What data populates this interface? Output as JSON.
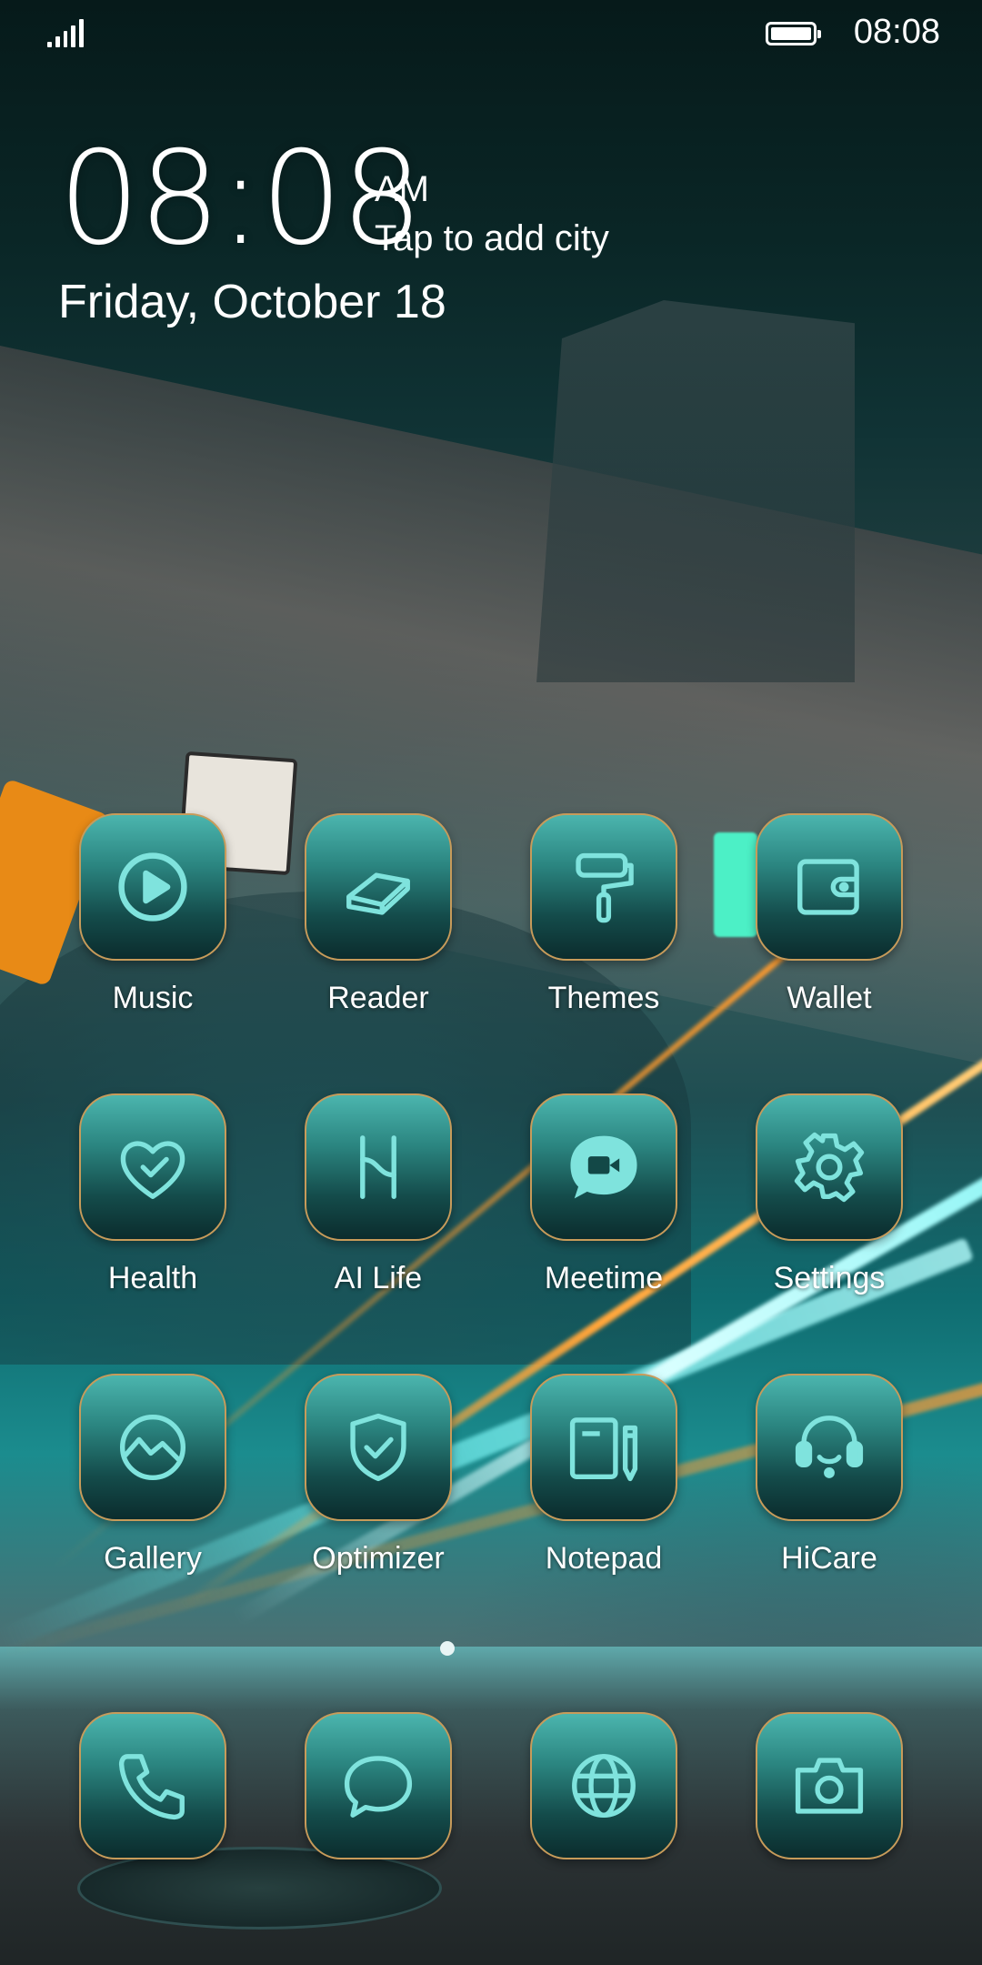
{
  "status_bar": {
    "time": "08:08",
    "signal_icon": "signal-icon",
    "battery_icon": "battery-full-icon"
  },
  "clock": {
    "time": "08:08",
    "ampm": "AM",
    "city_prompt": "Tap to add city",
    "date": "Friday, October 18"
  },
  "apps": [
    {
      "label": "Music",
      "icon": "play-circle-icon"
    },
    {
      "label": "Reader",
      "icon": "book-icon"
    },
    {
      "label": "Themes",
      "icon": "paint-roller-icon"
    },
    {
      "label": "Wallet",
      "icon": "wallet-icon"
    },
    {
      "label": "Health",
      "icon": "heart-check-icon"
    },
    {
      "label": "AI Life",
      "icon": "ai-life-icon"
    },
    {
      "label": "Meetime",
      "icon": "video-chat-icon"
    },
    {
      "label": "Settings",
      "icon": "gear-icon"
    },
    {
      "label": "Gallery",
      "icon": "gallery-icon"
    },
    {
      "label": "Optimizer",
      "icon": "shield-check-icon"
    },
    {
      "label": "Notepad",
      "icon": "notepad-icon"
    },
    {
      "label": "HiCare",
      "icon": "headset-icon"
    }
  ],
  "dock": [
    {
      "icon": "phone-icon"
    },
    {
      "icon": "message-icon"
    },
    {
      "icon": "browser-globe-icon"
    },
    {
      "icon": "camera-icon"
    }
  ],
  "colors": {
    "icon_stroke": "#7fe3dd",
    "tile_border": "#c79b5a"
  }
}
